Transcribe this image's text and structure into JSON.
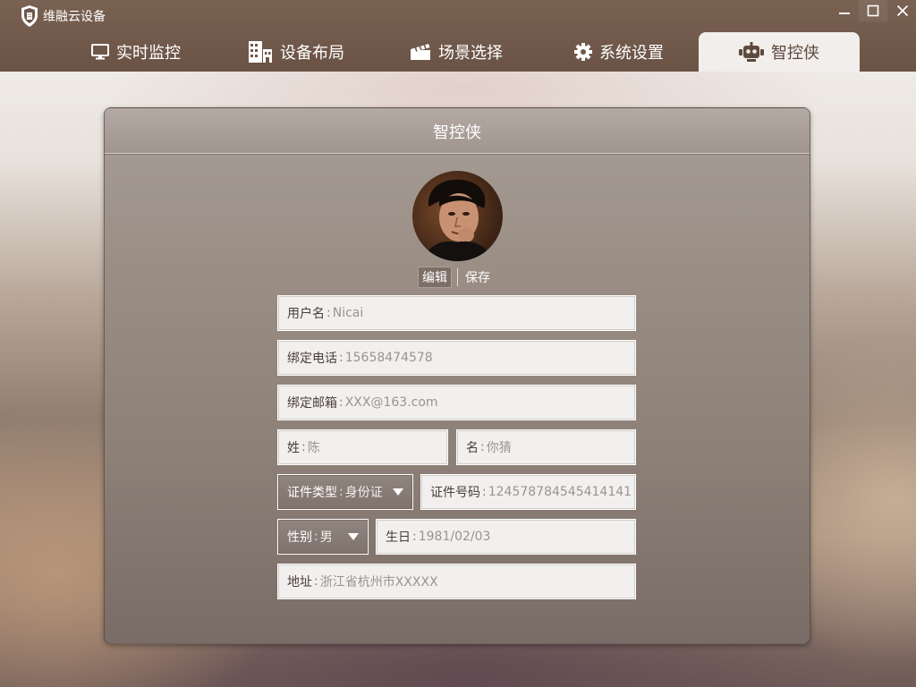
{
  "app": {
    "title": "维融云设备"
  },
  "tabs": [
    {
      "label": "实时监控",
      "icon": "monitor-icon",
      "active": false
    },
    {
      "label": "设备布局",
      "icon": "building-icon",
      "active": false
    },
    {
      "label": "场景选择",
      "icon": "clapperboard-icon",
      "active": false
    },
    {
      "label": "系统设置",
      "icon": "gear-icon",
      "active": false
    },
    {
      "label": "智控侠",
      "icon": "robot-icon",
      "active": true
    }
  ],
  "panel": {
    "title": "智控侠",
    "edit_label": "编辑",
    "save_label": "保存"
  },
  "form": {
    "username": {
      "label": "用户名",
      "value": "Nicai"
    },
    "phone": {
      "label": "绑定电话",
      "value": "15658474578"
    },
    "email": {
      "label": "绑定邮箱",
      "value": "XXX@163.com"
    },
    "surname": {
      "label": "姓",
      "value": "陈"
    },
    "given_name": {
      "label": "名",
      "value": "你猜"
    },
    "id_type": {
      "label": "证件类型",
      "value": "身份证"
    },
    "id_number": {
      "label": "证件号码",
      "value": "124578784545414141"
    },
    "gender": {
      "label": "性别",
      "value": "男"
    },
    "birthday": {
      "label": "生日",
      "value": "1981/02/03"
    },
    "address": {
      "label": "地址",
      "value": "浙江省杭州市XXXXX"
    }
  },
  "colors": {
    "titlebar": "#6f5749",
    "active_tab_bg": "#f1eeeb",
    "panel_bg": "#9a8e85"
  }
}
